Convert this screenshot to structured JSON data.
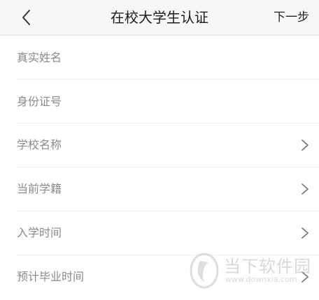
{
  "header": {
    "title": "在校大学生认证",
    "next_label": "下一步"
  },
  "form": {
    "real_name": {
      "placeholder": "真实姓名"
    },
    "id_number": {
      "placeholder": "身份证号"
    },
    "school_name": {
      "label": "学校名称"
    },
    "student_status": {
      "label": "当前学籍"
    },
    "enrollment_time": {
      "label": "入学时间"
    },
    "graduation_time": {
      "label": "预计毕业时间"
    }
  },
  "watermark": {
    "name": "当下软件园",
    "url": "www.downxia.com"
  },
  "colors": {
    "background": "#f4f4f4",
    "header_bg": "#f7f7f7",
    "row_bg": "#ffffff",
    "label": "#8a8a8a",
    "divider": "#ececec"
  },
  "icons": [
    "back-chevron-icon",
    "chevron-right-icon"
  ]
}
